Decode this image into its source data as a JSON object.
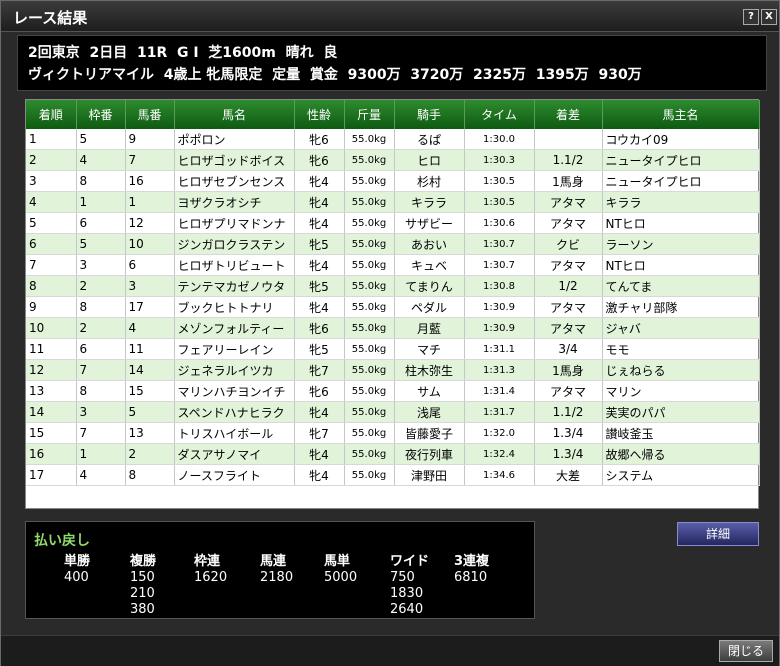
{
  "window": {
    "title": "レース結果",
    "help_label": "?",
    "close_label": "X"
  },
  "race": {
    "line1": "2回東京  2日目  11R  G I  芝1600m  晴れ  良",
    "line2": "ヴィクトリアマイル  4歳上 牝馬限定  定量  賞金  9300万  3720万  2325万  1395万  930万"
  },
  "table": {
    "headers": [
      "着順",
      "枠番",
      "馬番",
      "馬名",
      "性齢",
      "斤量",
      "騎手",
      "タイム",
      "着差",
      "馬主名"
    ],
    "rows": [
      [
        "1",
        "5",
        "9",
        "ポポロン",
        "牝6",
        "55.0kg",
        "るぱ",
        "1:30.0",
        "",
        "コウカイ09"
      ],
      [
        "2",
        "4",
        "7",
        "ヒロザゴッドボイス",
        "牝6",
        "55.0kg",
        "ヒロ",
        "1:30.3",
        "1.1/2",
        "ニュータイプヒロ"
      ],
      [
        "3",
        "8",
        "16",
        "ヒロザセブンセンス",
        "牝4",
        "55.0kg",
        "杉村",
        "1:30.5",
        "1馬身",
        "ニュータイプヒロ"
      ],
      [
        "4",
        "1",
        "1",
        "ヨザクラオシチ",
        "牝4",
        "55.0kg",
        "キララ",
        "1:30.5",
        "アタマ",
        "キララ"
      ],
      [
        "5",
        "6",
        "12",
        "ヒロザプリマドンナ",
        "牝4",
        "55.0kg",
        "サザビー",
        "1:30.6",
        "アタマ",
        "NTヒロ"
      ],
      [
        "6",
        "5",
        "10",
        "ジンガロクラステン",
        "牝5",
        "55.0kg",
        "あおい",
        "1:30.7",
        "クビ",
        "ラーソン"
      ],
      [
        "7",
        "3",
        "6",
        "ヒロザトリビュート",
        "牝4",
        "55.0kg",
        "キュベ",
        "1:30.7",
        "アタマ",
        "NTヒロ"
      ],
      [
        "8",
        "2",
        "3",
        "テンテマカゼノウタ",
        "牝5",
        "55.0kg",
        "てまりん",
        "1:30.8",
        "1/2",
        "てんてま"
      ],
      [
        "9",
        "8",
        "17",
        "ブックヒトトナリ",
        "牝4",
        "55.0kg",
        "ペダル",
        "1:30.9",
        "アタマ",
        "激チャリ部隊"
      ],
      [
        "10",
        "2",
        "4",
        "メゾンフォルティー",
        "牝6",
        "55.0kg",
        "月藍",
        "1:30.9",
        "アタマ",
        "ジャバ"
      ],
      [
        "11",
        "6",
        "11",
        "フェアリーレイン",
        "牝5",
        "55.0kg",
        "マチ",
        "1:31.1",
        "3/4",
        "モモ"
      ],
      [
        "12",
        "7",
        "14",
        "ジェネラルイツカ",
        "牝7",
        "55.0kg",
        "柱木弥生",
        "1:31.3",
        "1馬身",
        "じぇねらる"
      ],
      [
        "13",
        "8",
        "15",
        "マリンハチヨンイチ",
        "牝6",
        "55.0kg",
        "サム",
        "1:31.4",
        "アタマ",
        "マリン"
      ],
      [
        "14",
        "3",
        "5",
        "スペンドハナヒラク",
        "牝4",
        "55.0kg",
        "浅尾",
        "1:31.7",
        "1.1/2",
        "芙実のパパ"
      ],
      [
        "15",
        "7",
        "13",
        "トリスハイボール",
        "牝7",
        "55.0kg",
        "皆藤愛子",
        "1:32.0",
        "1.3/4",
        "讃岐釜玉"
      ],
      [
        "16",
        "1",
        "2",
        "ダスアサノマイ",
        "牝4",
        "55.0kg",
        "夜行列車",
        "1:32.4",
        "1.3/4",
        "故郷へ帰る"
      ],
      [
        "17",
        "4",
        "8",
        "ノースフライト",
        "牝4",
        "55.0kg",
        "津野田",
        "1:34.6",
        "大差",
        "システム"
      ]
    ]
  },
  "payout": {
    "title": "払い戻し",
    "columns": [
      {
        "label": "単勝",
        "values": [
          "400"
        ]
      },
      {
        "label": "複勝",
        "values": [
          "150",
          "210",
          "380"
        ]
      },
      {
        "label": "枠連",
        "values": [
          "1620"
        ]
      },
      {
        "label": "馬連",
        "values": [
          "2180"
        ]
      },
      {
        "label": "馬単",
        "values": [
          "5000"
        ]
      },
      {
        "label": "ワイド",
        "values": [
          "750",
          "1830",
          "2640"
        ]
      },
      {
        "label": "3連複",
        "values": [
          "6810"
        ]
      }
    ]
  },
  "buttons": {
    "detail": "詳細",
    "close": "閉じる"
  }
}
